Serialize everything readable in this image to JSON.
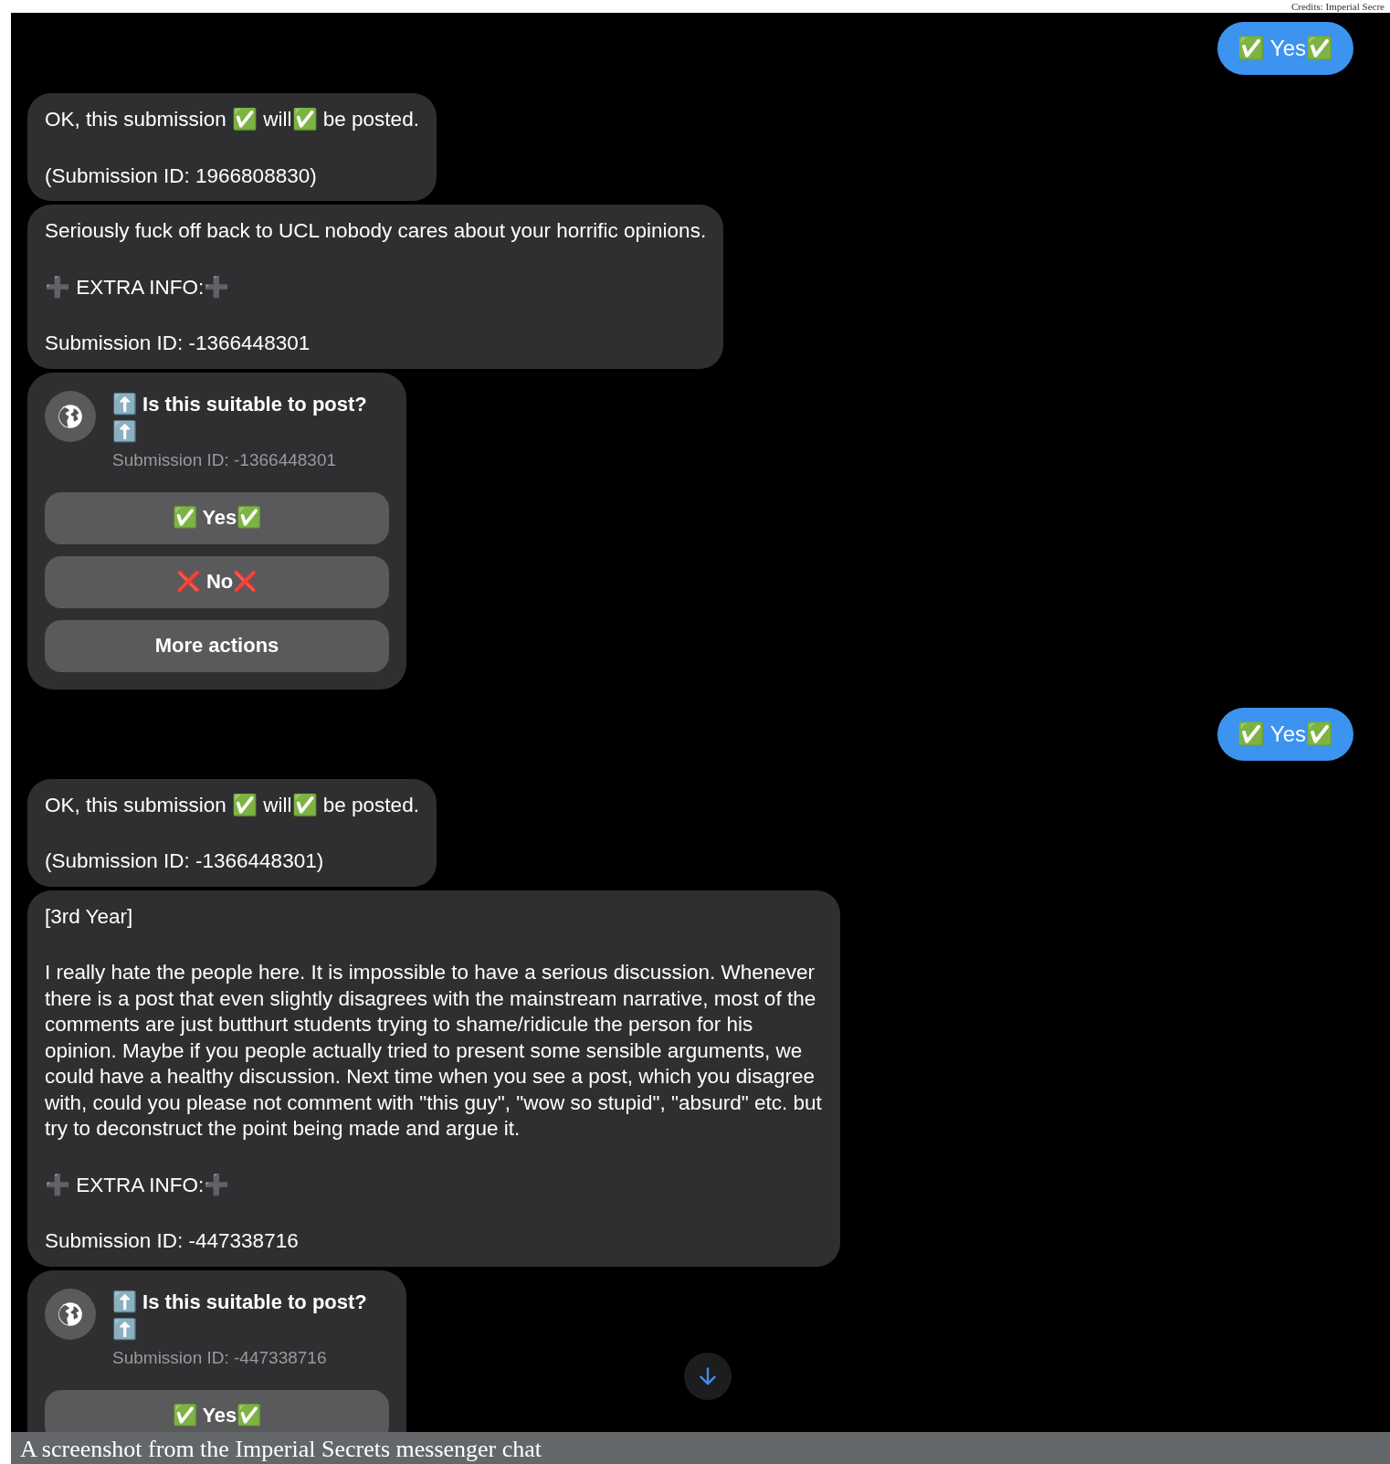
{
  "credits": "Credits: Imperial Secre",
  "messages": [
    {
      "kind": "outgoing",
      "text": "✅ Yes✅"
    },
    {
      "kind": "incoming",
      "paragraphs": [
        "OK, this submission ✅ will✅ be posted.",
        "(Submission ID: 1966808830)"
      ]
    },
    {
      "kind": "incoming",
      "paragraphs": [
        "Seriously fuck off back to UCL nobody cares about your horrific opinions.",
        "➕ EXTRA INFO:➕",
        "Submission ID: -1366448301"
      ]
    },
    {
      "kind": "poll",
      "title": "⬆️ Is this suitable to post? ⬆️",
      "subtitle": "Submission ID: -1366448301",
      "buttons": [
        "✅ Yes✅",
        "❌ No❌",
        "More actions"
      ]
    },
    {
      "kind": "outgoing",
      "text": "✅ Yes✅"
    },
    {
      "kind": "incoming",
      "paragraphs": [
        "OK, this submission ✅ will✅ be posted.",
        "(Submission ID: -1366448301)"
      ]
    },
    {
      "kind": "incoming",
      "paragraphs": [
        "[3rd Year]",
        "I really hate the people here. It is impossible to have a serious discussion. Whenever there is a post that even slightly disagrees with the mainstream narrative, most of the comments are just butthurt students trying to shame/ridicule the person for his opinion. Maybe if you people actually tried to present some sensible arguments, we could have a healthy discussion. Next time when you see a post, which you disagree with, could you please not comment with \"this guy\", \"wow so stupid\", \"absurd\" etc. but try to deconstruct the point being made and argue it.",
        "➕ EXTRA INFO:➕",
        "Submission ID: -447338716"
      ]
    },
    {
      "kind": "poll",
      "title": "⬆️ Is this suitable to post? ⬆️",
      "subtitle": "Submission ID: -447338716",
      "buttons": [
        "✅ Yes✅"
      ]
    }
  ],
  "caption": "A screenshot from the Imperial Secrets messenger chat"
}
